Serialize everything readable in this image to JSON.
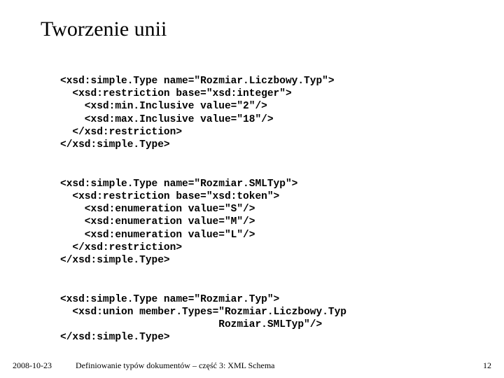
{
  "title": "Tworzenie unii",
  "code": {
    "block1": [
      "<xsd:simple.Type name=\"Rozmiar.Liczbowy.Typ\">",
      "  <xsd:restriction base=\"xsd:integer\">",
      "    <xsd:min.Inclusive value=\"2\"/>",
      "    <xsd:max.Inclusive value=\"18\"/>",
      "  </xsd:restriction>",
      "</xsd:simple.Type>"
    ],
    "block2": [
      "<xsd:simple.Type name=\"Rozmiar.SMLTyp\">",
      "  <xsd:restriction base=\"xsd:token\">",
      "    <xsd:enumeration value=\"S\"/>",
      "    <xsd:enumeration value=\"M\"/>",
      "    <xsd:enumeration value=\"L\"/>",
      "  </xsd:restriction>",
      "</xsd:simple.Type>"
    ],
    "block3": {
      "l1_a": "<xsd:simple.Type name=\"Rozmiar.Typ\">",
      "l2_a": "  <xsd:",
      "l2_b": "union",
      "l2_c": " ",
      "l2_d": "member.Types",
      "l2_e": "=\"Rozmiar.Liczbowy.Typ",
      "l3": "                          Rozmiar.SMLTyp\"/>",
      "l4": "</xsd:simple.Type>"
    }
  },
  "footer": {
    "date": "2008-10-23",
    "center": "Definiowanie typów dokumentów – część 3: XML Schema",
    "page": "12"
  }
}
